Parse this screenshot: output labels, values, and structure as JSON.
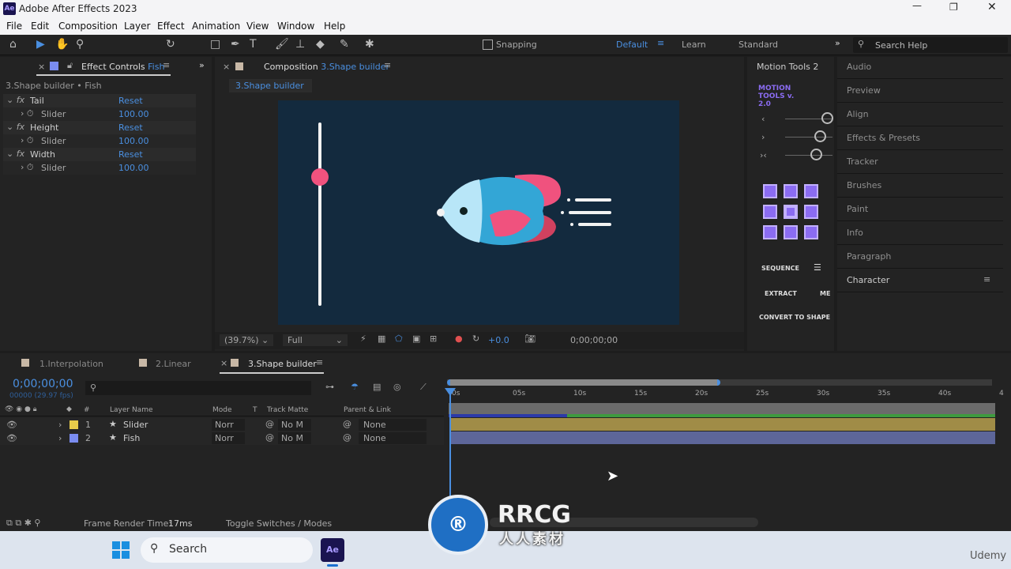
{
  "app": {
    "title": "Adobe After Effects 2023",
    "logo": "Ae"
  },
  "menu": [
    "File",
    "Edit",
    "Composition",
    "Layer",
    "Effect",
    "Animation",
    "View",
    "Window",
    "Help"
  ],
  "toolbar": {
    "snapping": "Snapping",
    "workspaces": [
      "Default",
      "Learn",
      "Standard"
    ],
    "search_placeholder": "Search Help"
  },
  "effect_controls": {
    "tab": "Effect Controls",
    "layer": "Fish",
    "breadcrumb": "3.Shape builder • Fish",
    "effects": [
      {
        "name": "Tail",
        "reset": "Reset",
        "param": "Slider",
        "value": "100.00"
      },
      {
        "name": "Height",
        "reset": "Reset",
        "param": "Slider",
        "value": "100.00"
      },
      {
        "name": "Width",
        "reset": "Reset",
        "param": "Slider",
        "value": "100.00"
      }
    ]
  },
  "composition": {
    "tab": "Composition",
    "name": "3.Shape builder",
    "subtab": "3.Shape builder",
    "zoom": "(39.7%)",
    "resolution": "Full",
    "exposure": "+0.0",
    "timecode": "0;00;00;00",
    "bg_color": "#132a3e"
  },
  "motion_tools": {
    "tab": "Motion Tools 2",
    "logo": "MOTION TOOLS v. 2.0",
    "buttons": [
      "SEQUENCE",
      "EXTRACT",
      "ME",
      "CONVERT TO SHAPE"
    ],
    "accent": "#8b6cf2"
  },
  "side_panels": [
    "Audio",
    "Preview",
    "Align",
    "Effects & Presets",
    "Tracker",
    "Brushes",
    "Paint",
    "Info",
    "Paragraph",
    "Character"
  ],
  "timeline": {
    "tabs": [
      "1.Interpolation",
      "2.Linear",
      "3.Shape builder"
    ],
    "timecode": "0;00;00;00",
    "fps": "00000 (29.97 fps)",
    "columns": [
      "#",
      "Layer Name",
      "Mode",
      "T",
      "Track Matte",
      "Parent & Link"
    ],
    "layers": [
      {
        "num": "1",
        "name": "Slider",
        "mode": "Norr",
        "matte": "No M",
        "parent": "None",
        "color": "#e8cc4a",
        "bar": "#a08c47"
      },
      {
        "num": "2",
        "name": "Fish",
        "mode": "Norr",
        "matte": "No M",
        "parent": "None",
        "color": "#7a8cf0",
        "bar": "#5d6699"
      }
    ],
    "ruler": [
      "0s",
      "05s",
      "10s",
      "15s",
      "20s",
      "25s",
      "30s",
      "35s",
      "40s",
      "4"
    ],
    "render_time_label": "Frame Render Time:",
    "render_time": "17ms",
    "toggle": "Toggle Switches / Modes"
  },
  "taskbar": {
    "search": "Search",
    "app": "Ae"
  },
  "watermark": {
    "text": "RRCG",
    "sub": "人人素材",
    "brand": "Udemy"
  }
}
